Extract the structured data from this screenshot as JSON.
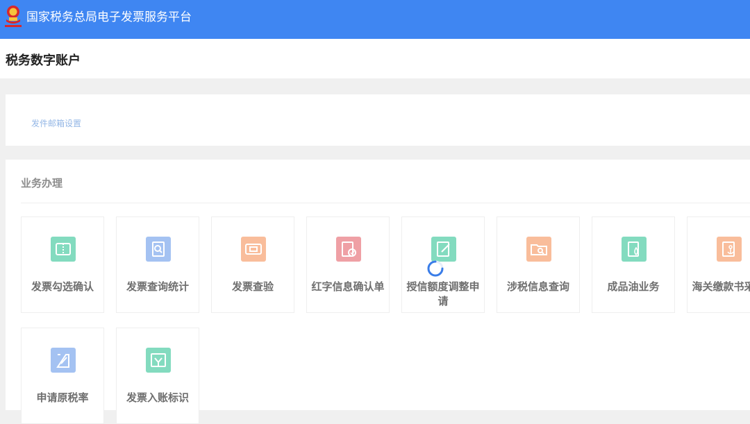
{
  "topbar": {
    "title": "国家税务总局电子发票服务平台"
  },
  "header": {
    "page_title": "税务数字账户"
  },
  "settings": {
    "email_link": "发件邮箱设置"
  },
  "business": {
    "section_title": "业务办理",
    "tiles": [
      {
        "label": "发票勾选确认",
        "icon": "ticket-check-icon",
        "color": "#1fbf8c"
      },
      {
        "label": "发票查询统计",
        "icon": "doc-search-icon",
        "color": "#5b92e8"
      },
      {
        "label": "发票查验",
        "icon": "ticket-verify-icon",
        "color": "#f5884a"
      },
      {
        "label": "红字信息确认单",
        "icon": "doc-check-icon",
        "color": "#e3545d"
      },
      {
        "label": "授信额度调整申请",
        "icon": "edit-doc-icon",
        "color": "#1fbf8c"
      },
      {
        "label": "涉税信息查询",
        "icon": "folder-search-icon",
        "color": "#f5884a"
      },
      {
        "label": "成品油业务",
        "icon": "oil-drop-icon",
        "color": "#1fbf8c"
      },
      {
        "label": "海关缴款书采集",
        "icon": "customs-anchor-icon",
        "color": "#f5884a"
      },
      {
        "label": "申请原税率",
        "icon": "form-edit-icon",
        "color": "#5b92e8"
      },
      {
        "label": "发票入账标识",
        "icon": "invoice-record-icon",
        "color": "#1fbf8c"
      }
    ]
  },
  "colors": {
    "topbar": "#3f86f2",
    "spinner": "#3a7de8"
  }
}
